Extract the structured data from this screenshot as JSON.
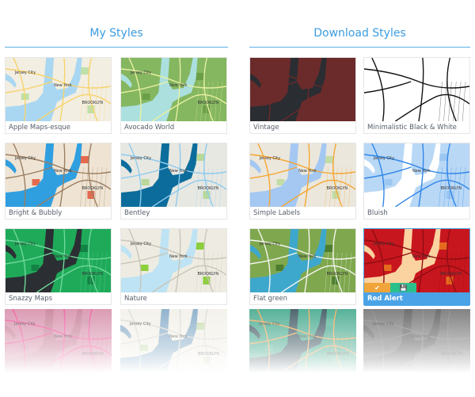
{
  "sections": {
    "my_styles": {
      "title": "My Styles",
      "cards": [
        {
          "label": "Apple Maps-esque",
          "colors": {
            "land": "#f3eee2",
            "water": "#a9d7f2",
            "road": "#f6d36a",
            "park": "#bfe0a8"
          }
        },
        {
          "label": "Avocado World",
          "colors": {
            "land": "#85b660",
            "water": "#abe0df",
            "road": "#e8f0a0",
            "park": "#6a9f48"
          }
        },
        {
          "label": "Bright & Bubbly",
          "colors": {
            "land": "#efe4d4",
            "water": "#2f9fe0",
            "road": "#9b7e60",
            "park": "#e46a4f"
          }
        },
        {
          "label": "Bentley",
          "colors": {
            "land": "#e8e8e2",
            "water": "#0c6d9c",
            "road": "#8ecbee",
            "park": "#b9d89a"
          }
        },
        {
          "label": "Snazzy Maps",
          "colors": {
            "land": "#1faa5a",
            "water": "#2b2f33",
            "road": "#6fd99a",
            "park": "#138244"
          }
        },
        {
          "label": "Nature",
          "colors": {
            "land": "#eeece2",
            "water": "#bde3f4",
            "road": "#c9c5b8",
            "park": "#8ccf3c"
          }
        }
      ],
      "faded": [
        {
          "colors": {
            "land": "#d48aa6",
            "water": "#c47892",
            "road": "#f04a94",
            "park": "#c989a2"
          }
        },
        {
          "colors": {
            "land": "#f1efe7",
            "water": "#7fa6c4",
            "road": "#d8d8d0",
            "park": "#c6dcae"
          }
        }
      ]
    },
    "download_styles": {
      "title": "Download Styles",
      "cards": [
        {
          "label": "Vintage",
          "colors": {
            "land": "#6b2b2b",
            "water": "#2a2d32",
            "road": "#6b2b2b",
            "park": "#6b2b2b"
          }
        },
        {
          "label": "Minimalistic Black & White",
          "colors": {
            "land": "#ffffff",
            "water": "#ffffff",
            "road": "#111111",
            "park": "#ffffff"
          }
        },
        {
          "label": "Simple Labels",
          "colors": {
            "land": "#ebe7dc",
            "water": "#a4c8f2",
            "road": "#f4a632",
            "park": "#c3dca6"
          }
        },
        {
          "label": "Bluish",
          "colors": {
            "land": "#b9d8f6",
            "water": "#ffffff",
            "road": "#2f86e8",
            "park": "#9cc7f2"
          }
        },
        {
          "label": "Flat green",
          "colors": {
            "land": "#7fa84e",
            "water": "#3ea7cc",
            "road": "#f6f6f0",
            "park": "#4d7d2e"
          }
        },
        {
          "label": "Red Alert",
          "colors": {
            "land": "#c8161e",
            "water": "#fbd3a0",
            "road": "#8f0d12",
            "park": "#e66a1e"
          },
          "selected": true,
          "actions": [
            {
              "name": "apply",
              "icon": "checkmark-icon",
              "glyph": "✔"
            },
            {
              "name": "save",
              "icon": "floppy-disk-icon",
              "glyph": "💾"
            }
          ]
        }
      ],
      "faded": [
        {
          "colors": {
            "land": "#3aa487",
            "water": "#2f4b55",
            "road": "#f0a24c",
            "park": "#4aae8f"
          }
        },
        {
          "colors": {
            "land": "#6d6d6d",
            "water": "#555555",
            "road": "#7a7a7a",
            "park": "#666666"
          }
        }
      ]
    }
  },
  "map_labels": {
    "city1": "Jersey City",
    "city2": "New York",
    "borough": "BROOKLYN"
  }
}
